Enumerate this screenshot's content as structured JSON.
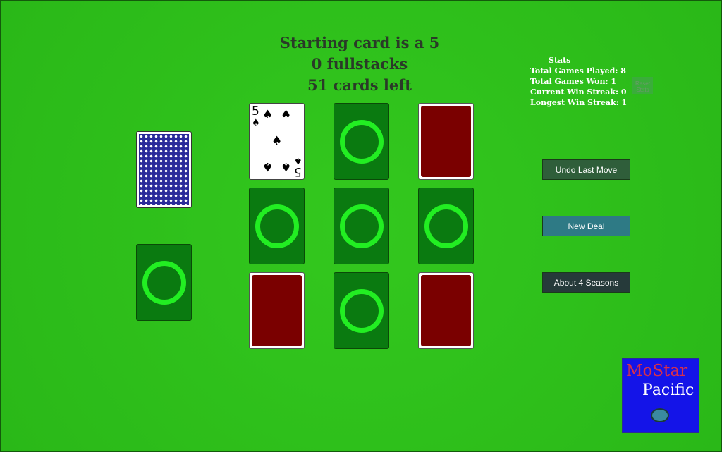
{
  "header": {
    "line1": "Starting card is a 5",
    "line2": "0 fullstacks",
    "line3": "51 cards left"
  },
  "stats": {
    "title": "Stats",
    "played": "Total Games Played: 8",
    "won": "Total Games Won: 1",
    "current": "Current Win Streak: 0",
    "longest": "Longest Win Streak: 1",
    "reset_label": "Reset Stats"
  },
  "buttons": {
    "undo": "Undo Last Move",
    "new_deal": "New Deal",
    "about": "About 4 Seasons"
  },
  "colors": {
    "felt": "#2ec21a",
    "undo": "#2f5e3a",
    "new_deal": "#2e7a85",
    "about": "#263a3a",
    "card_back_red": "#7a0000",
    "empty_ring": "#22ee22"
  },
  "board": {
    "face_card": {
      "rank": "5",
      "suit": "♠"
    },
    "grid": [
      [
        "face",
        "empty",
        "back-red"
      ],
      [
        "empty",
        "empty",
        "empty"
      ],
      [
        "back-red",
        "empty",
        "back-red"
      ]
    ]
  },
  "logo": {
    "line1": "MoStar",
    "line2": "Pacific",
    "icon": "sea-turtle-icon"
  }
}
